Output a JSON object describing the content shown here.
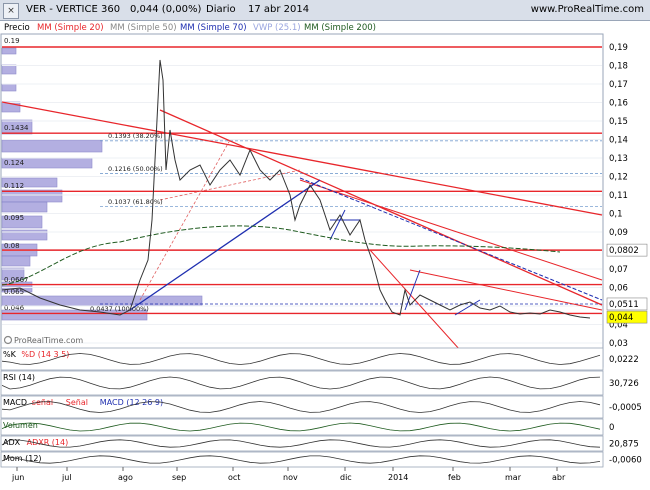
{
  "window": {
    "close_glyph": "×",
    "title": "VER - VERTICE 360",
    "last_value": "0,044 (0,00%)",
    "period": "Diario",
    "date": "17 abr 2014",
    "brand": "www.ProRealTime.com"
  },
  "legend": {
    "price": "Precio",
    "mm20": "MM (Simple 20)",
    "mm50": "MM (Simple 50)",
    "mm70": "MM (Simple 70)",
    "vwp": "VWP (25.1)",
    "mm200": "MM (Simple 200)"
  },
  "watermark": "ProRealTime.com",
  "y_axis": [
    "0,19",
    "0,18",
    "0,17",
    "0,16",
    "0,15",
    "0,14",
    "0,13",
    "0,12",
    "0,11",
    "0,1",
    "0,09",
    "0,08",
    "0,07",
    "0,06",
    "0,05",
    "0,04",
    "0,03"
  ],
  "price_tags": {
    "level_0802": "0,0802",
    "level_0511": "0,0511",
    "last": "0,044"
  },
  "colors": {
    "resistance": "#e8262b",
    "trend_blue": "#1f2fb0",
    "ma_green": "#1f5b1f",
    "profile": "#a6a2dc",
    "price_line": "#333333",
    "tag_yellow": "#ffff00"
  },
  "volume_profile_labels": [
    "0.19",
    "0.1434",
    "0.124",
    "0.112",
    "0.095",
    "0.08",
    "0.0667",
    "0.065",
    "0.046"
  ],
  "fib_labels": [
    "0.1393 (38.20%)",
    "0.1216 (50.00%)",
    "0.1037 (61.80%)",
    "0.0437 (100.00%)"
  ],
  "x_axis": [
    "jun",
    "jul",
    "ago",
    "sep",
    "oct",
    "nov",
    "dic",
    "2014",
    "feb",
    "mar",
    "abr"
  ],
  "panels": [
    {
      "label": "%K",
      "label2": "%D (14 3 5)",
      "value": "0,0222"
    },
    {
      "label": "RSI (14)",
      "value": "30,726"
    },
    {
      "label": "MACD",
      "label2": "señal",
      "label3": "Señal",
      "label4": "MACD (12 26 9)",
      "value": "-0,0005"
    },
    {
      "label": "Volumen",
      "value": "0"
    },
    {
      "label": "ADX",
      "label2": "ADXR (14)",
      "value": "20,875"
    },
    {
      "label": "Mom (12)",
      "value": "-0,0060"
    }
  ]
}
